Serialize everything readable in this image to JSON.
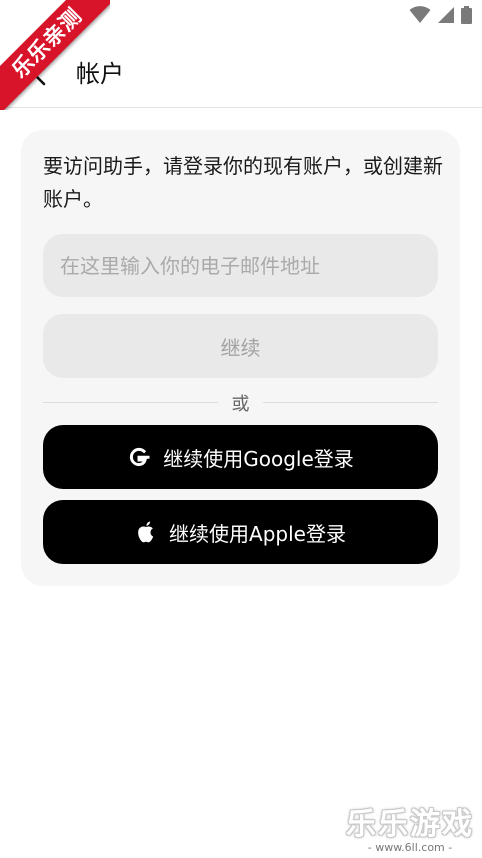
{
  "status_bar": {
    "icons": [
      "wifi-icon",
      "signal-icon",
      "battery-icon"
    ]
  },
  "ribbon": {
    "text": "乐乐亲测"
  },
  "header": {
    "back_icon": "chevron-left-icon",
    "title": "帐户"
  },
  "card": {
    "intro": "要访问助手，请登录你的现有账户，或创建新账户。",
    "email_placeholder": "在这里输入你的电子邮件地址",
    "email_value": "",
    "continue_label": "继续",
    "or_label": "或",
    "google_label": "继续使用Google登录",
    "google_icon": "google-icon",
    "apple_label": "继续使用Apple登录",
    "apple_icon": "apple-icon"
  },
  "watermark": {
    "main": "乐乐游戏",
    "sub": "- www.6ll.com -"
  },
  "colors": {
    "primary_button": "#000000",
    "card_bg": "#f6f6f6",
    "input_bg": "#e9e9e9",
    "ribbon": "#d8142a"
  }
}
